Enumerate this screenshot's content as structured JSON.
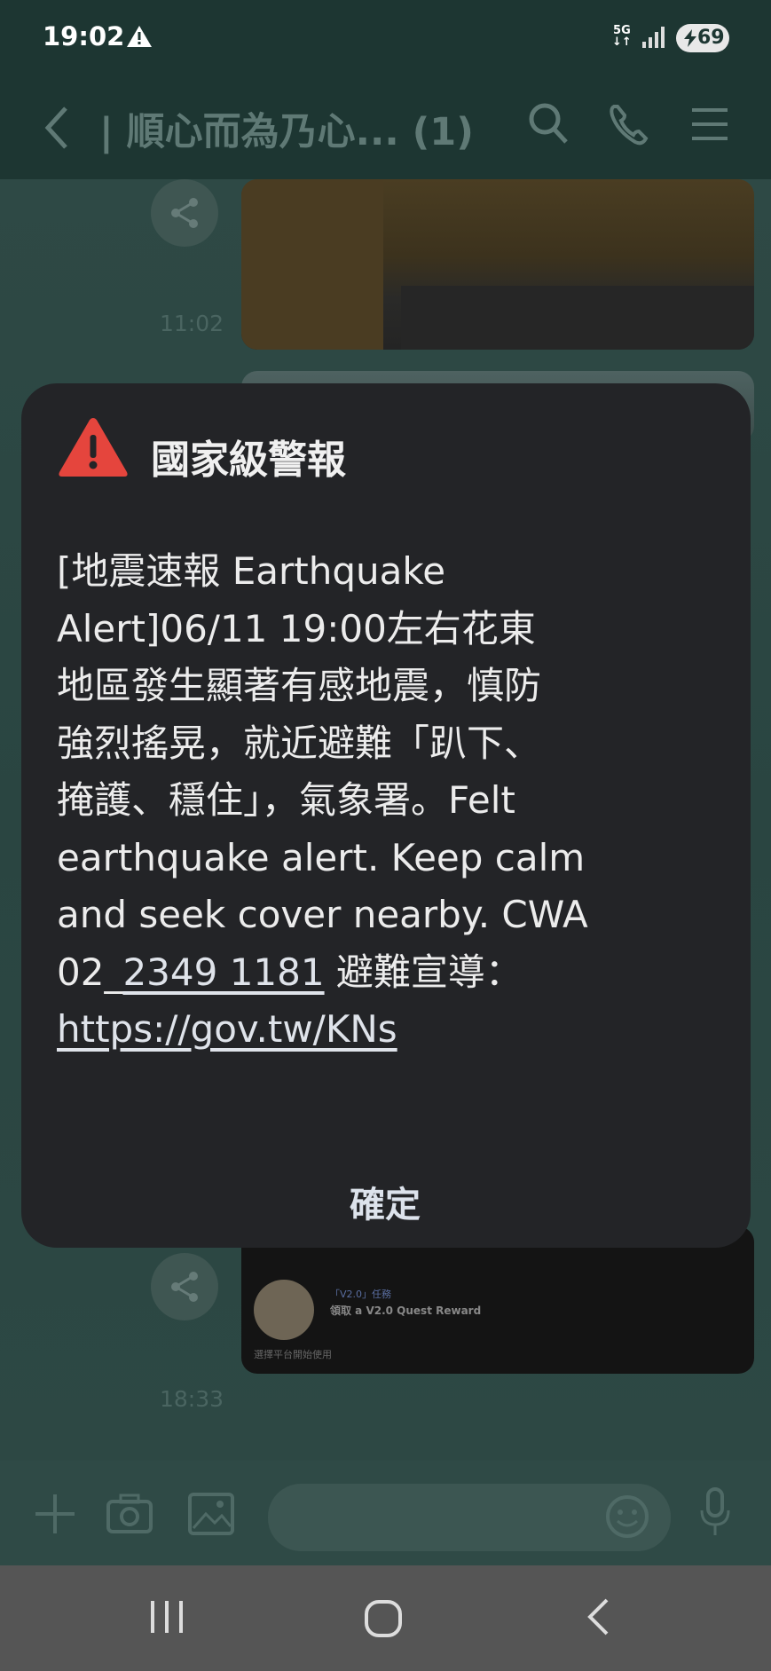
{
  "status_bar": {
    "time": "19:02",
    "network": "5G",
    "battery": "69"
  },
  "header": {
    "title": "| 順心而為乃心... (1)"
  },
  "chat": {
    "time_1": "11:02",
    "time_2": "18:33",
    "card_tag": "「V2.0」任務",
    "card_reward": "領取 a V2.0 Quest Reward",
    "card_footer": "選擇平台開始使用"
  },
  "alert": {
    "title": "國家級警報",
    "body_lines": [
      "[地震速報 Earthquake",
      "Alert]06/11 19:00左右花東",
      "地區發生顯著有感地震，慎防",
      "強烈搖晃，就近避難「趴下、",
      "掩護、穩住」，氣象署。Felt",
      "earthquake alert. Keep calm",
      "and seek cover nearby. CWA"
    ],
    "phone_prefix": "02_",
    "phone_link": "2349 1181",
    "phone_suffix": " 避難宣導：",
    "url": "https://gov.tw/KNs",
    "confirm_label": "確定"
  },
  "colors": {
    "alert_icon": "#e5453d",
    "dialog_bg": "#232427",
    "chat_bg": "#2b4642"
  }
}
